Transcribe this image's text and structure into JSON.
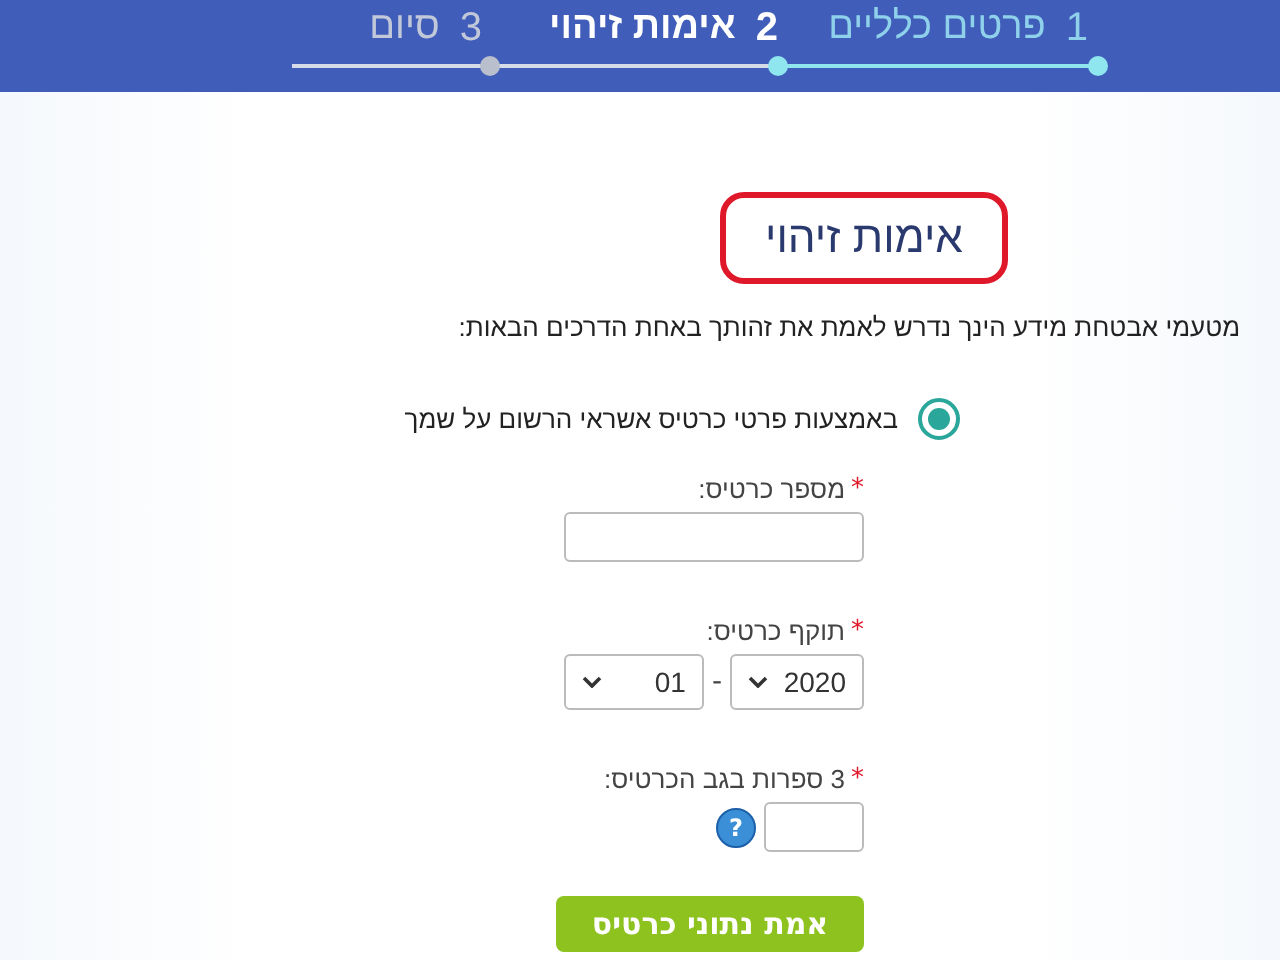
{
  "steps": [
    {
      "number": "1",
      "label": "פרטים כלליים",
      "completed": true,
      "selected": false
    },
    {
      "number": "2",
      "label": "אימות זיהוי",
      "completed": false,
      "selected": true
    },
    {
      "number": "3",
      "label": "סיום",
      "completed": false,
      "selected": false
    }
  ],
  "title": "אימות זיהוי",
  "intro": "מטעמי אבטחת מידע הינך נדרש לאמת את זהותך באחת הדרכים הבאות:",
  "methods": [
    {
      "label": "באמצעות פרטי כרטיס אשראי הרשום על שמך",
      "selected": true
    }
  ],
  "fields": [
    {
      "kind": "text",
      "label": "מספר כרטיס:",
      "required_mark": "*"
    },
    {
      "kind": "date",
      "label": "תוקף כרטיס:",
      "required_mark": "*",
      "year": "2020",
      "separator": "-",
      "month": "01"
    },
    {
      "kind": "cvv",
      "label": "3 ספרות בגב הכרטיס:",
      "required_mark": "*",
      "help": "?"
    }
  ],
  "submit": "אמת נתוני כרטיס"
}
